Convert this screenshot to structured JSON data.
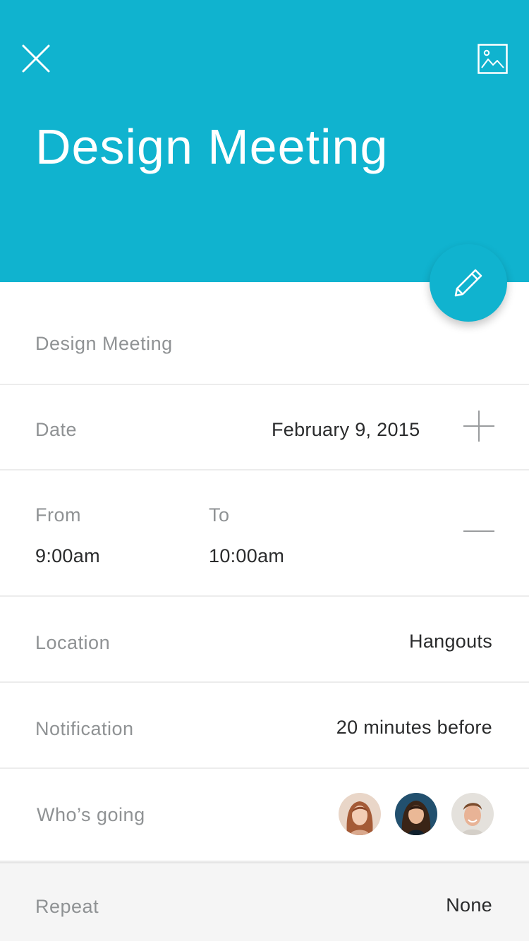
{
  "header": {
    "title": "Design Meeting",
    "background": "#10b3cf",
    "close_icon": "close-icon",
    "image_icon": "image-icon"
  },
  "fab": {
    "icon": "pencil-icon",
    "color": "#10b3cf"
  },
  "form": {
    "title_value": "Design Meeting",
    "date": {
      "label": "Date",
      "value": "February 9, 2015",
      "action_icon": "plus-icon"
    },
    "time": {
      "from_label": "From",
      "from_value": "9:00am",
      "to_label": "To",
      "to_value": "10:00am",
      "action_icon": "minus-icon"
    },
    "location": {
      "label": "Location",
      "value": "Hangouts"
    },
    "notification": {
      "label": "Notification",
      "value": "20 minutes before"
    },
    "attendees": {
      "label": "Who’s going",
      "avatars": [
        "avatar-1",
        "avatar-2",
        "avatar-3"
      ]
    },
    "repeat": {
      "label": "Repeat",
      "value": "None"
    }
  }
}
